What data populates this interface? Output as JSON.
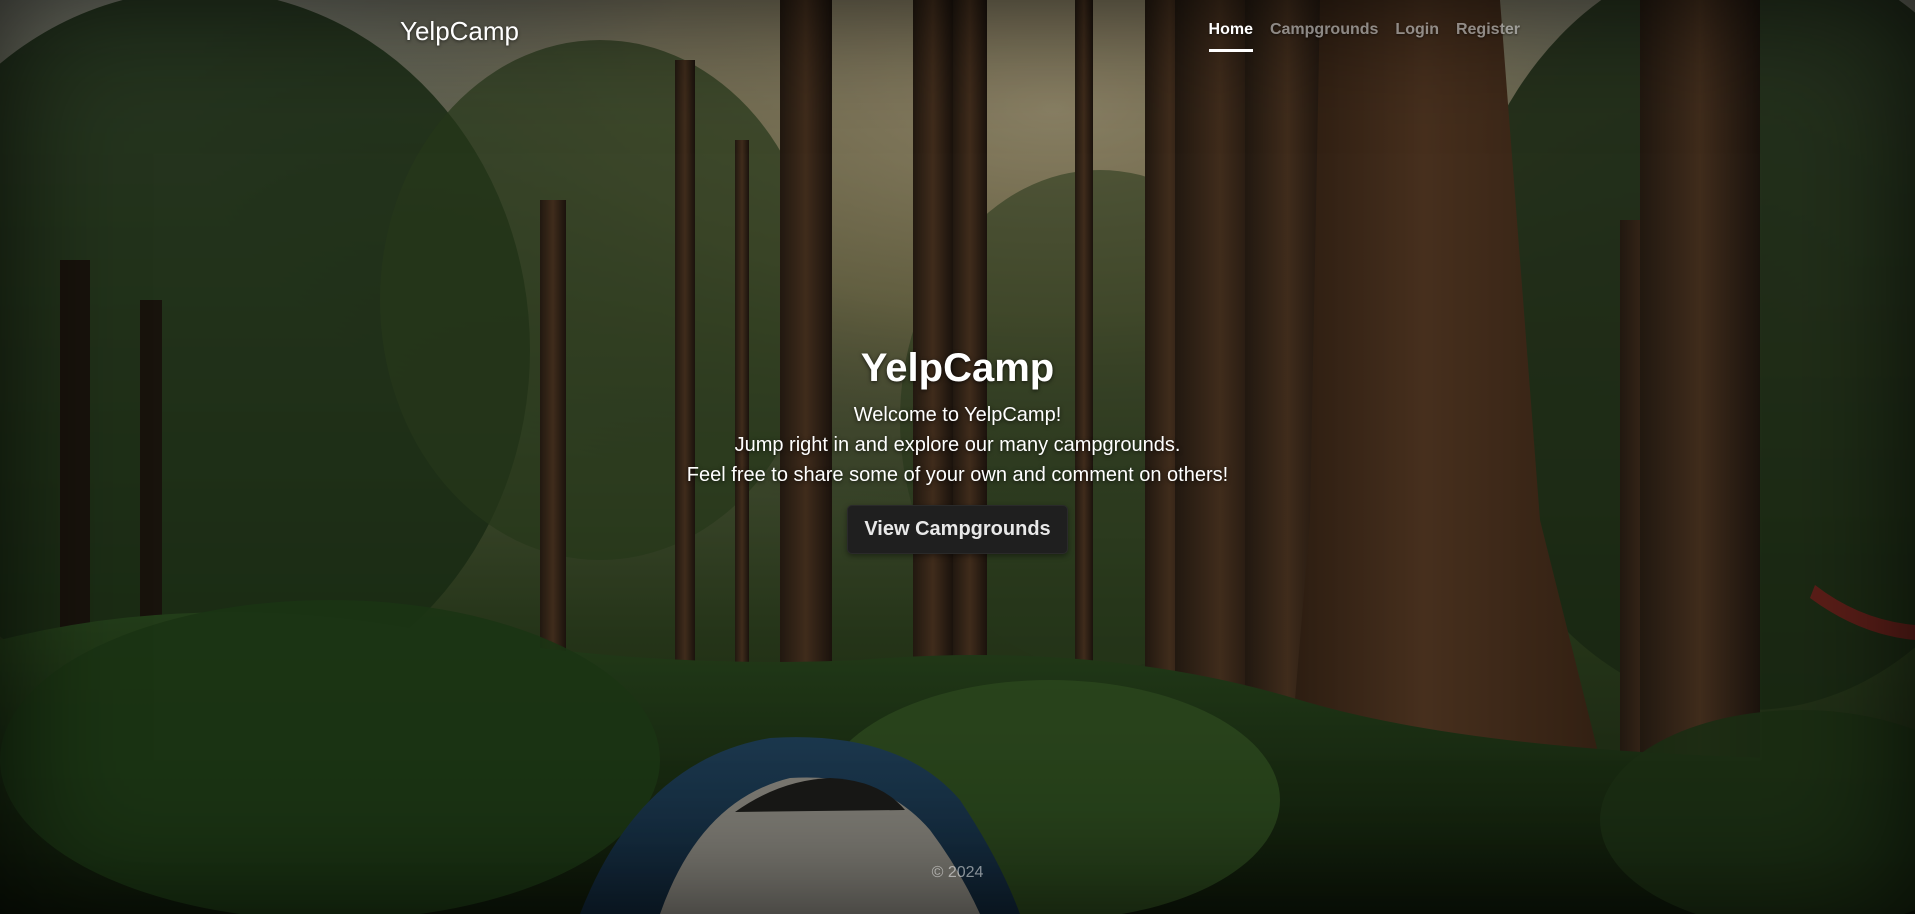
{
  "header": {
    "brand": "YelpCamp",
    "nav": [
      {
        "label": "Home",
        "active": true
      },
      {
        "label": "Campgrounds",
        "active": false
      },
      {
        "label": "Login",
        "active": false
      },
      {
        "label": "Register",
        "active": false
      }
    ]
  },
  "hero": {
    "title": "YelpCamp",
    "lines": [
      "Welcome to YelpCamp!",
      "Jump right in and explore our many campgrounds.",
      "Feel free to share some of your own and comment on others!"
    ],
    "cta_label": "View Campgrounds"
  },
  "footer": {
    "copyright": "© 2024"
  },
  "theme": {
    "overlay": "#000000",
    "button_bg": "#1f1f1f",
    "text": "#ffffff",
    "muted_text": "#ffffff80"
  }
}
